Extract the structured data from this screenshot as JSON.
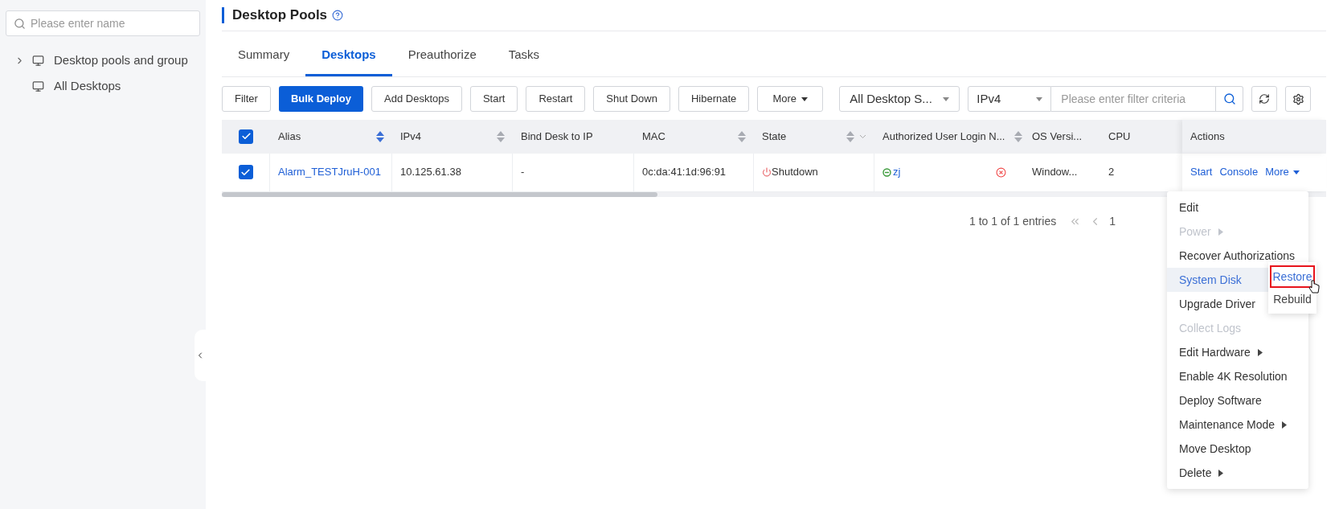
{
  "sidebar": {
    "search": {
      "placeholder": "Please enter name"
    },
    "tree": [
      {
        "label": "Desktop pools and group",
        "expandable": true,
        "expanded": false
      },
      {
        "label": "All Desktops",
        "expandable": false
      }
    ]
  },
  "page": {
    "title": "Desktop Pools"
  },
  "tabs": [
    {
      "label": "Summary",
      "selected": false
    },
    {
      "label": "Desktops",
      "selected": true
    },
    {
      "label": "Preauthorize",
      "selected": false
    },
    {
      "label": "Tasks",
      "selected": false
    }
  ],
  "toolbar": {
    "buttons": [
      {
        "label": "Filter",
        "kind": "default"
      },
      {
        "label": "Bulk Deploy",
        "kind": "primary"
      },
      {
        "label": "Add Desktops",
        "kind": "default"
      },
      {
        "label": "Start",
        "kind": "default"
      },
      {
        "label": "Restart",
        "kind": "default"
      },
      {
        "label": "Shut Down",
        "kind": "default"
      },
      {
        "label": "Hibernate",
        "kind": "default"
      },
      {
        "label": "More",
        "kind": "dropdown"
      }
    ],
    "status_select": {
      "value": "All Desktop S..."
    },
    "field_select": {
      "value": "IPv4"
    },
    "filter": {
      "placeholder": "Please enter filter criteria"
    }
  },
  "table": {
    "all_checked": true,
    "columns": [
      {
        "label": "Alias",
        "sortable": true,
        "sort_active": true
      },
      {
        "label": "IPv4",
        "sortable": true,
        "sort_active": false
      },
      {
        "label": "Bind Desk to IP",
        "sortable": false
      },
      {
        "label": "MAC",
        "sortable": true,
        "sort_active": false
      },
      {
        "label": "State",
        "sortable": true,
        "sort_active": false,
        "filterable": true
      },
      {
        "label": "Authorized User Login N...",
        "sortable": true,
        "sort_active": false
      },
      {
        "label": "OS Versi...",
        "sortable": false
      },
      {
        "label": "CPU",
        "sortable": false
      },
      {
        "label": "Actions",
        "sortable": false
      }
    ],
    "rows": [
      {
        "checked": true,
        "alias": "Alarm_TESTJruH-001",
        "ipv4": "10.125.61.38",
        "bind": "-",
        "mac": "0c:da:41:1d:96:91",
        "state": "Shutdown",
        "user": "zj",
        "os": "Window...",
        "cpu": "2",
        "actions": [
          "Start",
          "Console"
        ],
        "more": "More"
      }
    ]
  },
  "pagination": {
    "summary": "1 to 1 of 1 entries",
    "page": "1"
  },
  "context_menu": {
    "items": [
      {
        "label": "Edit",
        "disabled": false,
        "submenu": false,
        "highlighted": false
      },
      {
        "label": "Power",
        "disabled": true,
        "submenu": true,
        "highlighted": false
      },
      {
        "label": "Recover Authorizations",
        "disabled": false,
        "submenu": false,
        "highlighted": false
      },
      {
        "label": "System Disk",
        "disabled": false,
        "submenu": false,
        "highlighted": true
      },
      {
        "label": "Upgrade Driver",
        "disabled": false,
        "submenu": false,
        "highlighted": false
      },
      {
        "label": "Collect Logs",
        "disabled": true,
        "submenu": false,
        "highlighted": false
      },
      {
        "label": "Edit Hardware",
        "disabled": false,
        "submenu": true,
        "highlighted": false
      },
      {
        "label": "Enable 4K Resolution",
        "disabled": false,
        "submenu": false,
        "highlighted": false
      },
      {
        "label": "Deploy Software",
        "disabled": false,
        "submenu": false,
        "highlighted": false
      },
      {
        "label": "Maintenance Mode",
        "disabled": false,
        "submenu": true,
        "highlighted": false
      },
      {
        "label": "Move Desktop",
        "disabled": false,
        "submenu": false,
        "highlighted": false
      },
      {
        "label": "Delete",
        "disabled": false,
        "submenu": true,
        "highlighted": false
      }
    ],
    "submenu": [
      {
        "label": "Restore",
        "selected": true
      },
      {
        "label": "Rebuild",
        "selected": false
      }
    ]
  }
}
